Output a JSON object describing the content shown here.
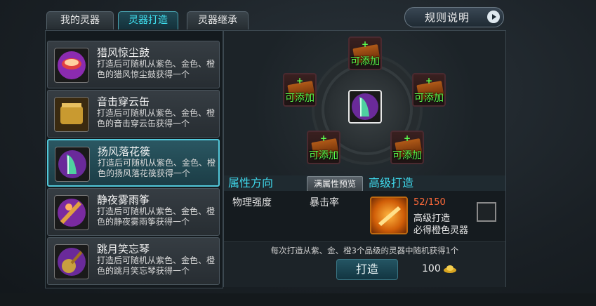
{
  "tabs": [
    {
      "label": "我的灵器",
      "active": false
    },
    {
      "label": "灵器打造",
      "active": true
    },
    {
      "label": "灵器继承",
      "active": false
    }
  ],
  "rules_button": {
    "label": "规则说明",
    "icon": "arrow-right-icon"
  },
  "items": [
    {
      "name": "猎风惊尘鼓",
      "desc": "打造后可随机从紫色、金色、橙色的猎风惊尘鼓获得一个",
      "selected": false
    },
    {
      "name": "音击穿云缶",
      "desc": "打造后可随机从紫色、金色、橙色的音击穿云缶获得一个",
      "selected": false
    },
    {
      "name": "扬风落花篌",
      "desc": "打造后可随机从紫色、金色、橙色的扬风落花篌获得一个",
      "selected": true
    },
    {
      "name": "静夜雾雨筝",
      "desc": "打造后可随机从紫色、金色、橙色的静夜雾雨筝获得一个",
      "selected": false
    },
    {
      "name": "跳月笑忘琴",
      "desc": "打造后可随机从紫色、金色、橙色的跳月笑忘琴获得一个",
      "selected": false
    }
  ],
  "slots": {
    "label": "可添加",
    "plus": "+"
  },
  "attr": {
    "title": "属性方向",
    "preview_label": "满属性预览",
    "values": [
      "物理强度",
      "暴击率"
    ]
  },
  "advanced": {
    "title": "高级打造",
    "count": "52/150",
    "line1": "高级打造",
    "line2": "必得橙色灵器"
  },
  "footer": {
    "note": "每次打造从紫、金、橙3个品级的灵器中随机获得1个",
    "forge_label": "打造",
    "cost": "100"
  },
  "colors": {
    "accent": "#3fd7ea",
    "slot_text": "#5cff4e",
    "count": "#ff6a3a"
  }
}
